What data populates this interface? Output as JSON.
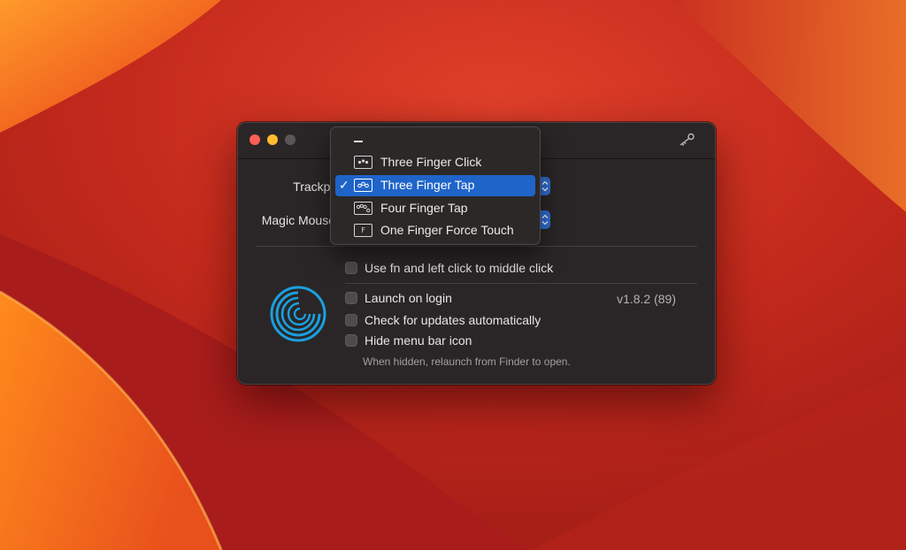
{
  "colors": {
    "accent": "#1f64c9",
    "window_bg": "#2a2627",
    "close": "#fe5f57",
    "minimize": "#febc2e",
    "zoom": "#5a5556",
    "logo": "#1aa0e0"
  },
  "titlebar": {
    "icon": "key-icon"
  },
  "settings": {
    "trackpad_label": "Trackpad",
    "magic_mouse_label": "Magic Mouse"
  },
  "menu": {
    "empty_option": "—",
    "items": [
      {
        "label": "Three Finger Click",
        "icon": "three-finger-click-icon",
        "selected": false
      },
      {
        "label": "Three Finger Tap",
        "icon": "three-finger-tap-icon",
        "selected": true
      },
      {
        "label": "Four Finger Tap",
        "icon": "four-finger-tap-icon",
        "selected": false
      },
      {
        "label": "One Finger Force Touch",
        "icon": "force-touch-icon",
        "icon_text": "F",
        "selected": false
      }
    ],
    "checkmark": "✓"
  },
  "options": {
    "fn_click": "Use fn and left click to middle click",
    "launch_on_login": "Launch on login",
    "check_updates": "Check for updates automatically",
    "hide_menu_icon": "Hide menu bar icon",
    "hide_hint": "When hidden, relaunch from Finder to open."
  },
  "version": "v1.8.2 (89)"
}
